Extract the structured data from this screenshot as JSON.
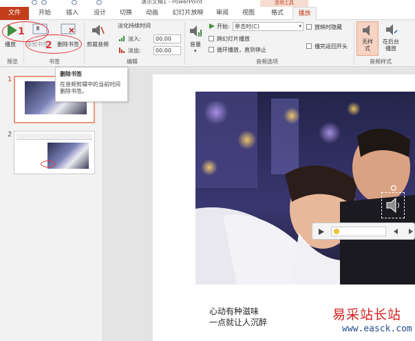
{
  "window": {
    "title": "演示文稿1 - PowerPoint",
    "context_tab_group": "音频工具"
  },
  "tabs": [
    "文件",
    "开始",
    "插入",
    "设计",
    "切换",
    "动画",
    "幻灯片放映",
    "审阅",
    "视图",
    "格式",
    "播放"
  ],
  "active_tab": "播放",
  "ribbon": {
    "preview": {
      "play_label": "播放",
      "group_label": "预览"
    },
    "bookmarks": {
      "add_label": "添加书签",
      "remove_label": "删除书签",
      "group_label": "书签"
    },
    "editing": {
      "trim_label": "剪裁音频",
      "fade_title": "淡化持续时间",
      "fade_in_label": "淡入:",
      "fade_in_value": "00.00",
      "fade_out_label": "淡出:",
      "fade_out_value": "00.00",
      "group_label": "编辑"
    },
    "audio_options": {
      "volume_label": "音量",
      "start_label": "开始:",
      "start_value": "单击时(C)",
      "across_slides": "跨幻灯片播放",
      "loop": "循环播放，直到停止",
      "hide_during_show": "放映时隐藏",
      "rewind": "播完返回开头",
      "group_label": "音频选项"
    },
    "audio_styles": {
      "none_label": "无样式",
      "background_label": "在后台播放",
      "group_label": "音频样式"
    }
  },
  "annotations": {
    "num1": "1",
    "num2": "2"
  },
  "tooltip": {
    "title": "删除书签",
    "description": "在音频剪辑中的当前时间删除书签。"
  },
  "thumbnails": [
    {
      "num": "1"
    },
    {
      "num": "2"
    }
  ],
  "slide": {
    "caption_line1": "心动有种滋味",
    "caption_line2": "一点就让人沉醉"
  },
  "watermark": {
    "text": "易采站长站",
    "url": "www.easck.com"
  },
  "colors": {
    "accent": "#c43e1c",
    "annotation": "#e0303a"
  }
}
